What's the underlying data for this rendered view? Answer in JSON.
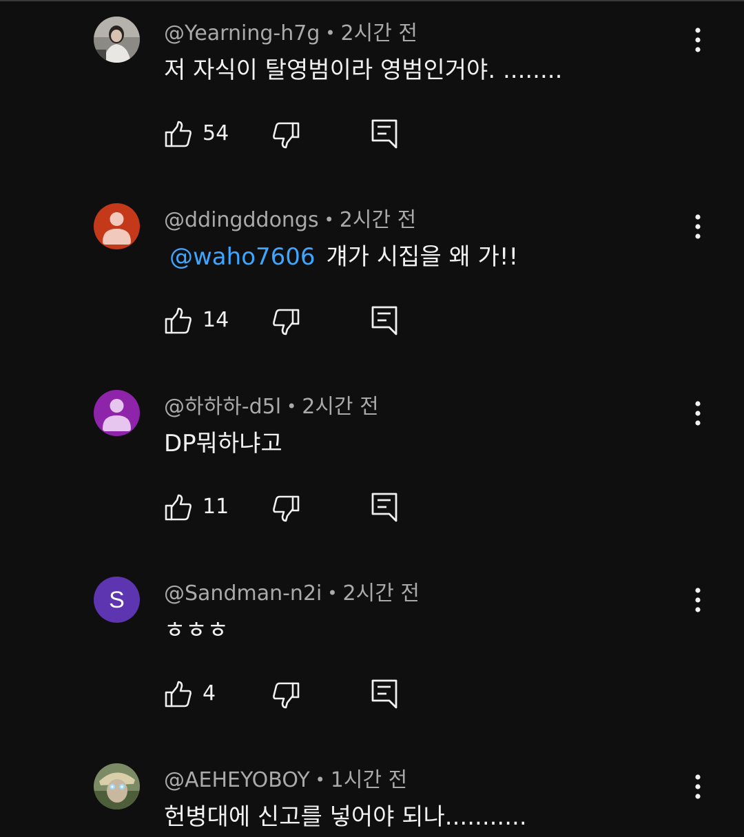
{
  "comments": [
    {
      "author": "@Yearning-h7g",
      "time": "2시간 전",
      "mention": "",
      "text": "저 자식이 탈영범이라 영범인거야. ........",
      "likes": "54",
      "avatar": {
        "type": "photo",
        "color": "#8a8a86"
      }
    },
    {
      "author": "@ddingddongs",
      "time": "2시간 전",
      "mention": "@waho7606",
      "text": "걔가 시집을 왜 가!!",
      "likes": "14",
      "avatar": {
        "type": "default",
        "color": "#c4391a"
      }
    },
    {
      "author": "@하하하-d5l",
      "time": "2시간 전",
      "mention": "",
      "text": "DP뭐하냐고",
      "likes": "11",
      "avatar": {
        "type": "default",
        "color": "#8e24aa"
      }
    },
    {
      "author": "@Sandman-n2i",
      "time": "2시간 전",
      "mention": "",
      "text": "ㅎㅎㅎ",
      "likes": "4",
      "avatar": {
        "type": "letter",
        "letter": "S",
        "color": "#5e35b1"
      }
    },
    {
      "author": "@AEHEYOBOY",
      "time": "1시간 전",
      "mention": "",
      "text": "헌병대에 신고를 넣어야 되나...........",
      "likes": "",
      "avatar": {
        "type": "photo2",
        "color": "#6d7a5a"
      }
    }
  ],
  "icons": {
    "like": "thumbs-up-icon",
    "dislike": "thumbs-down-icon",
    "reply": "reply-icon",
    "more": "more-vert-icon"
  },
  "colors": {
    "background": "#0f0f0f",
    "text": "#f1f1f1",
    "secondary": "#aaaaaa",
    "mention": "#3ea6ff"
  }
}
